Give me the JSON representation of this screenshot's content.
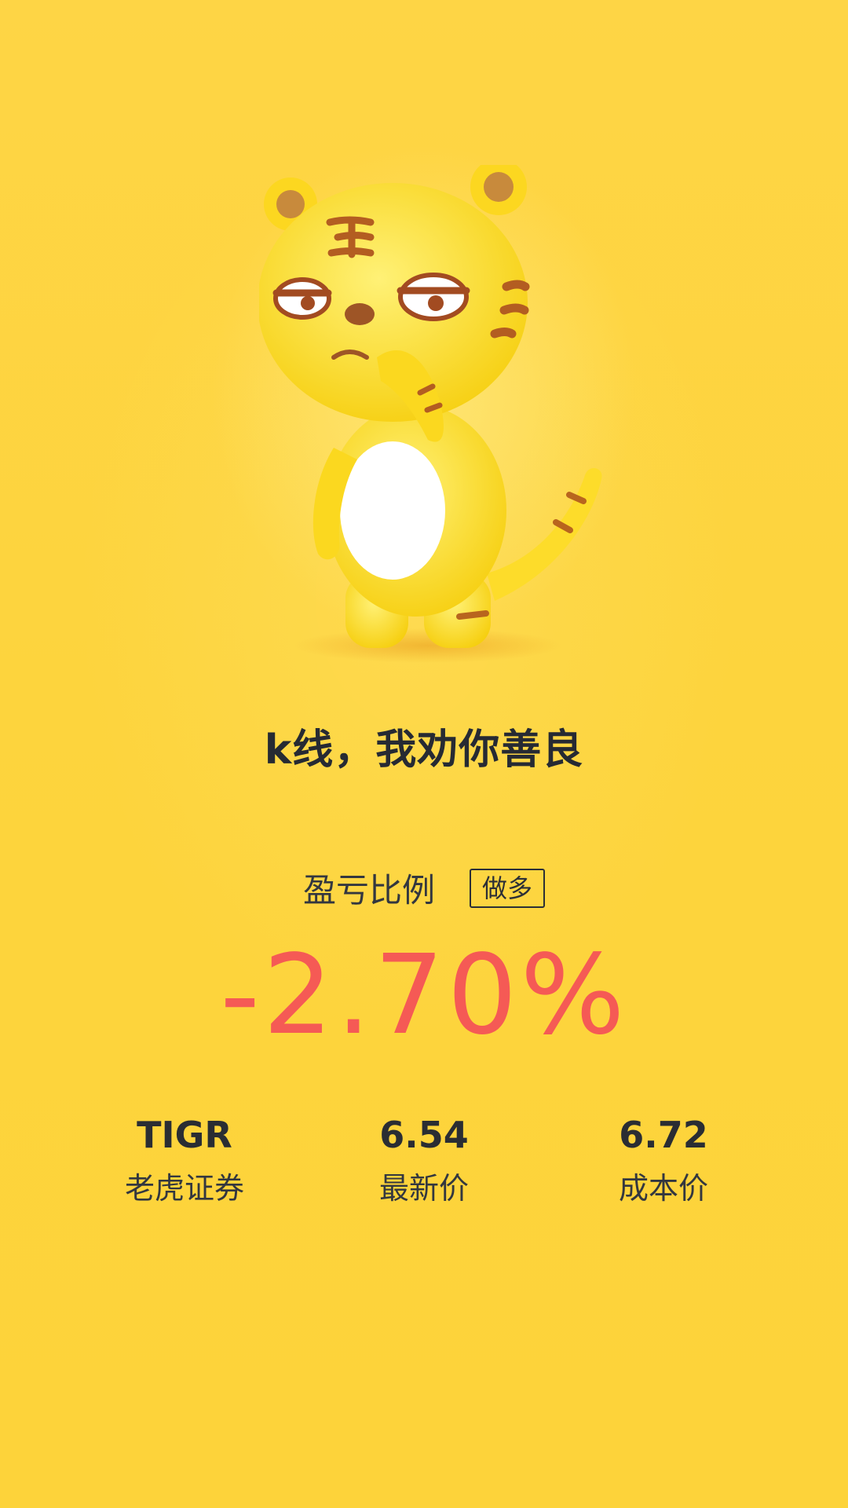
{
  "headline": "k线，我劝你善良",
  "pnl": {
    "label": "盈亏比例",
    "direction": "做多",
    "value": "-2.70%",
    "value_color": "#f55a55"
  },
  "stats": [
    {
      "value": "TIGR",
      "label": "老虎证券"
    },
    {
      "value": "6.54",
      "label": "最新价"
    },
    {
      "value": "6.72",
      "label": "成本价"
    }
  ],
  "colors": {
    "background": "#fdd43d",
    "text": "#262a33",
    "mascot_body": "#fde22a"
  },
  "mascot": {
    "icon": "tiger-mascot-icon"
  }
}
